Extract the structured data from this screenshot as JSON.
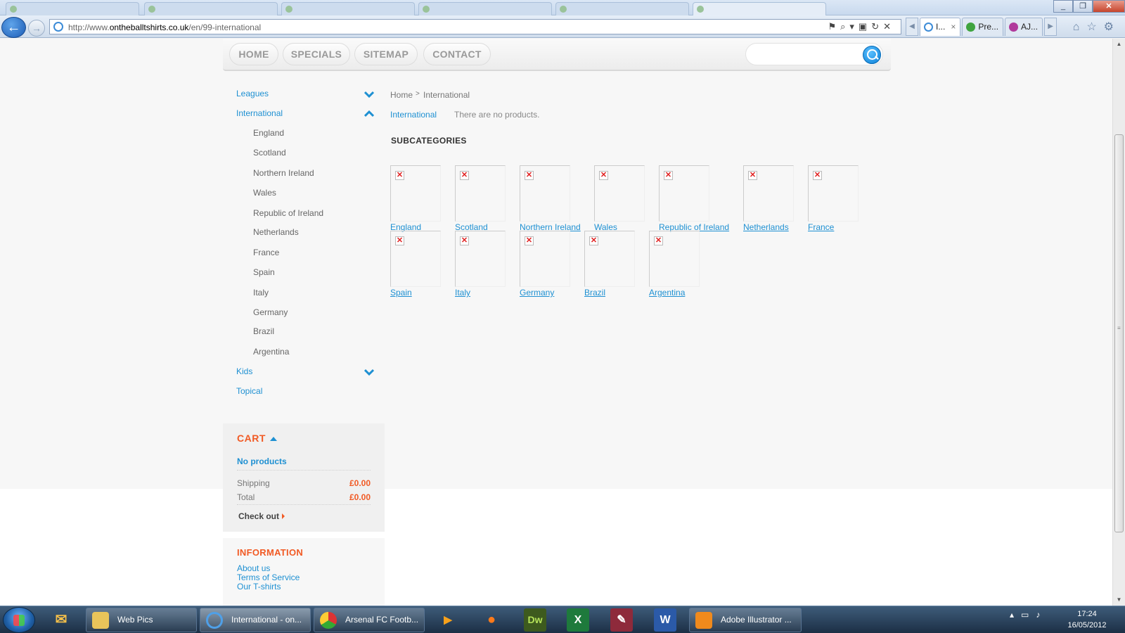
{
  "browser": {
    "url_prefix": "http://www.",
    "url_domain": "ontheballtshirts.co.uk",
    "url_path": "/en/99-international",
    "tabs": [
      {
        "label": "I...",
        "active": true
      },
      {
        "label": "Pre...",
        "active": false
      },
      {
        "label": "AJ...",
        "active": false
      }
    ],
    "close_tab": "×"
  },
  "menu": {
    "home": "HOME",
    "specials": "SPECIALS",
    "sitemap": "SITEMAP",
    "contact": "CONTACT",
    "search_placeholder": ""
  },
  "sidebar": {
    "categories": [
      {
        "label": "Leagues",
        "expanded": false
      },
      {
        "label": "International",
        "expanded": true
      },
      {
        "label": "Kids",
        "expanded": false
      },
      {
        "label": "Topical",
        "expanded": null
      }
    ],
    "subcategories": [
      "England",
      "Scotland",
      "Northern Ireland",
      "Wales",
      "Republic of Ireland",
      "Netherlands",
      "France",
      "Spain",
      "Italy",
      "Germany",
      "Brazil",
      "Argentina"
    ]
  },
  "cart": {
    "title": "CART",
    "empty": "No products",
    "shipping_label": "Shipping",
    "shipping_value": "£0.00",
    "total_label": "Total",
    "total_value": "£0.00",
    "checkout": "Check out"
  },
  "information": {
    "title": "INFORMATION",
    "links": [
      "About us",
      "Terms of Service",
      "Our T-shirts"
    ]
  },
  "main": {
    "breadcrumb_home": "Home",
    "breadcrumb_sep": ">",
    "breadcrumb_current": "International",
    "category_name": "International",
    "no_products": "There are no products.",
    "subcategories_title": "SUBCATEGORIES",
    "subcategories": [
      "England",
      "Scotland",
      "Northern Ireland",
      "Wales",
      "Republic of Ireland",
      "Netherlands",
      "France",
      "Spain",
      "Italy",
      "Germany",
      "Brazil",
      "Argentina"
    ]
  },
  "taskbar": {
    "apps": [
      "Web Pics",
      "International - on...",
      "Arsenal FC Footb...",
      "Adobe Illustrator ..."
    ],
    "time": "17:24",
    "date": "16/05/2012"
  },
  "colors": {
    "accent_blue": "#1e90d2",
    "accent_orange": "#f15a24"
  }
}
